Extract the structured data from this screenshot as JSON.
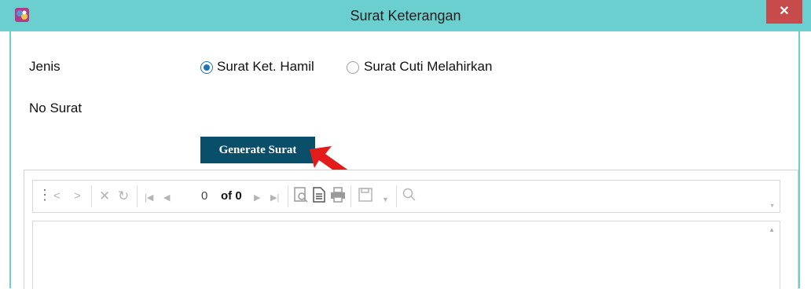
{
  "window": {
    "title": "Surat Keterangan",
    "close_glyph": "✕"
  },
  "form": {
    "jenis_label": "Jenis",
    "options": [
      {
        "label": "Surat Ket. Hamil",
        "selected": true
      },
      {
        "label": "Surat Cuti Melahirkan",
        "selected": false
      }
    ],
    "no_surat_label": "No Surat",
    "no_surat_value": "",
    "generate_label": "Generate Surat"
  },
  "viewer": {
    "current_page": "0",
    "page_of": "of 0"
  },
  "colors": {
    "titlebar": "#6ccfcf",
    "button": "#0a4f6a",
    "close": "#c84b4b",
    "arrow": "#e31b1b",
    "radio": "#1e73be"
  },
  "icons": [
    "app-icon",
    "close-icon",
    "grip-icon",
    "back-icon",
    "forward-icon",
    "stop-icon",
    "refresh-icon",
    "first-page-icon",
    "prev-page-icon",
    "next-page-icon",
    "last-page-icon",
    "print-layout-icon",
    "page-setup-icon",
    "print-icon",
    "save-icon",
    "dropdown-icon",
    "search-icon",
    "red-arrow-icon"
  ]
}
